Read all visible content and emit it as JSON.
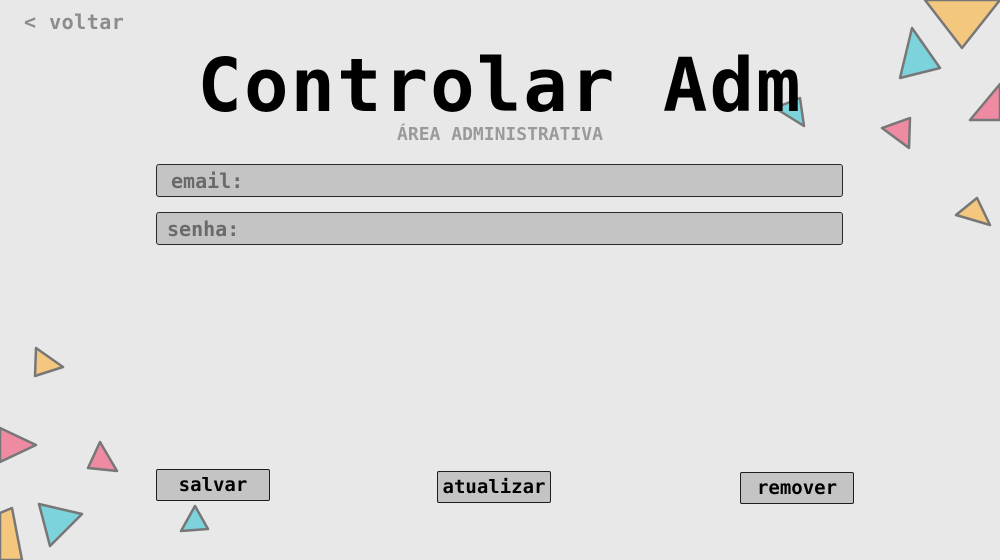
{
  "nav": {
    "back_label": "< voltar"
  },
  "header": {
    "title": "Controlar Adm",
    "subtitle": "ÁREA ADMINISTRATIVA"
  },
  "form": {
    "email": {
      "placeholder": "email:",
      "value": ""
    },
    "senha": {
      "placeholder": "senha:",
      "value": ""
    }
  },
  "actions": {
    "save_label": "salvar",
    "update_label": "atualizar",
    "remove_label": "remover"
  },
  "colors": {
    "background": "#e8e8e8",
    "field_background": "#c4c4c4",
    "triangle_orange": "#f4c77f",
    "triangle_cyan": "#7dd3db",
    "triangle_pink": "#ef8aa3",
    "triangle_outline": "#777777"
  }
}
